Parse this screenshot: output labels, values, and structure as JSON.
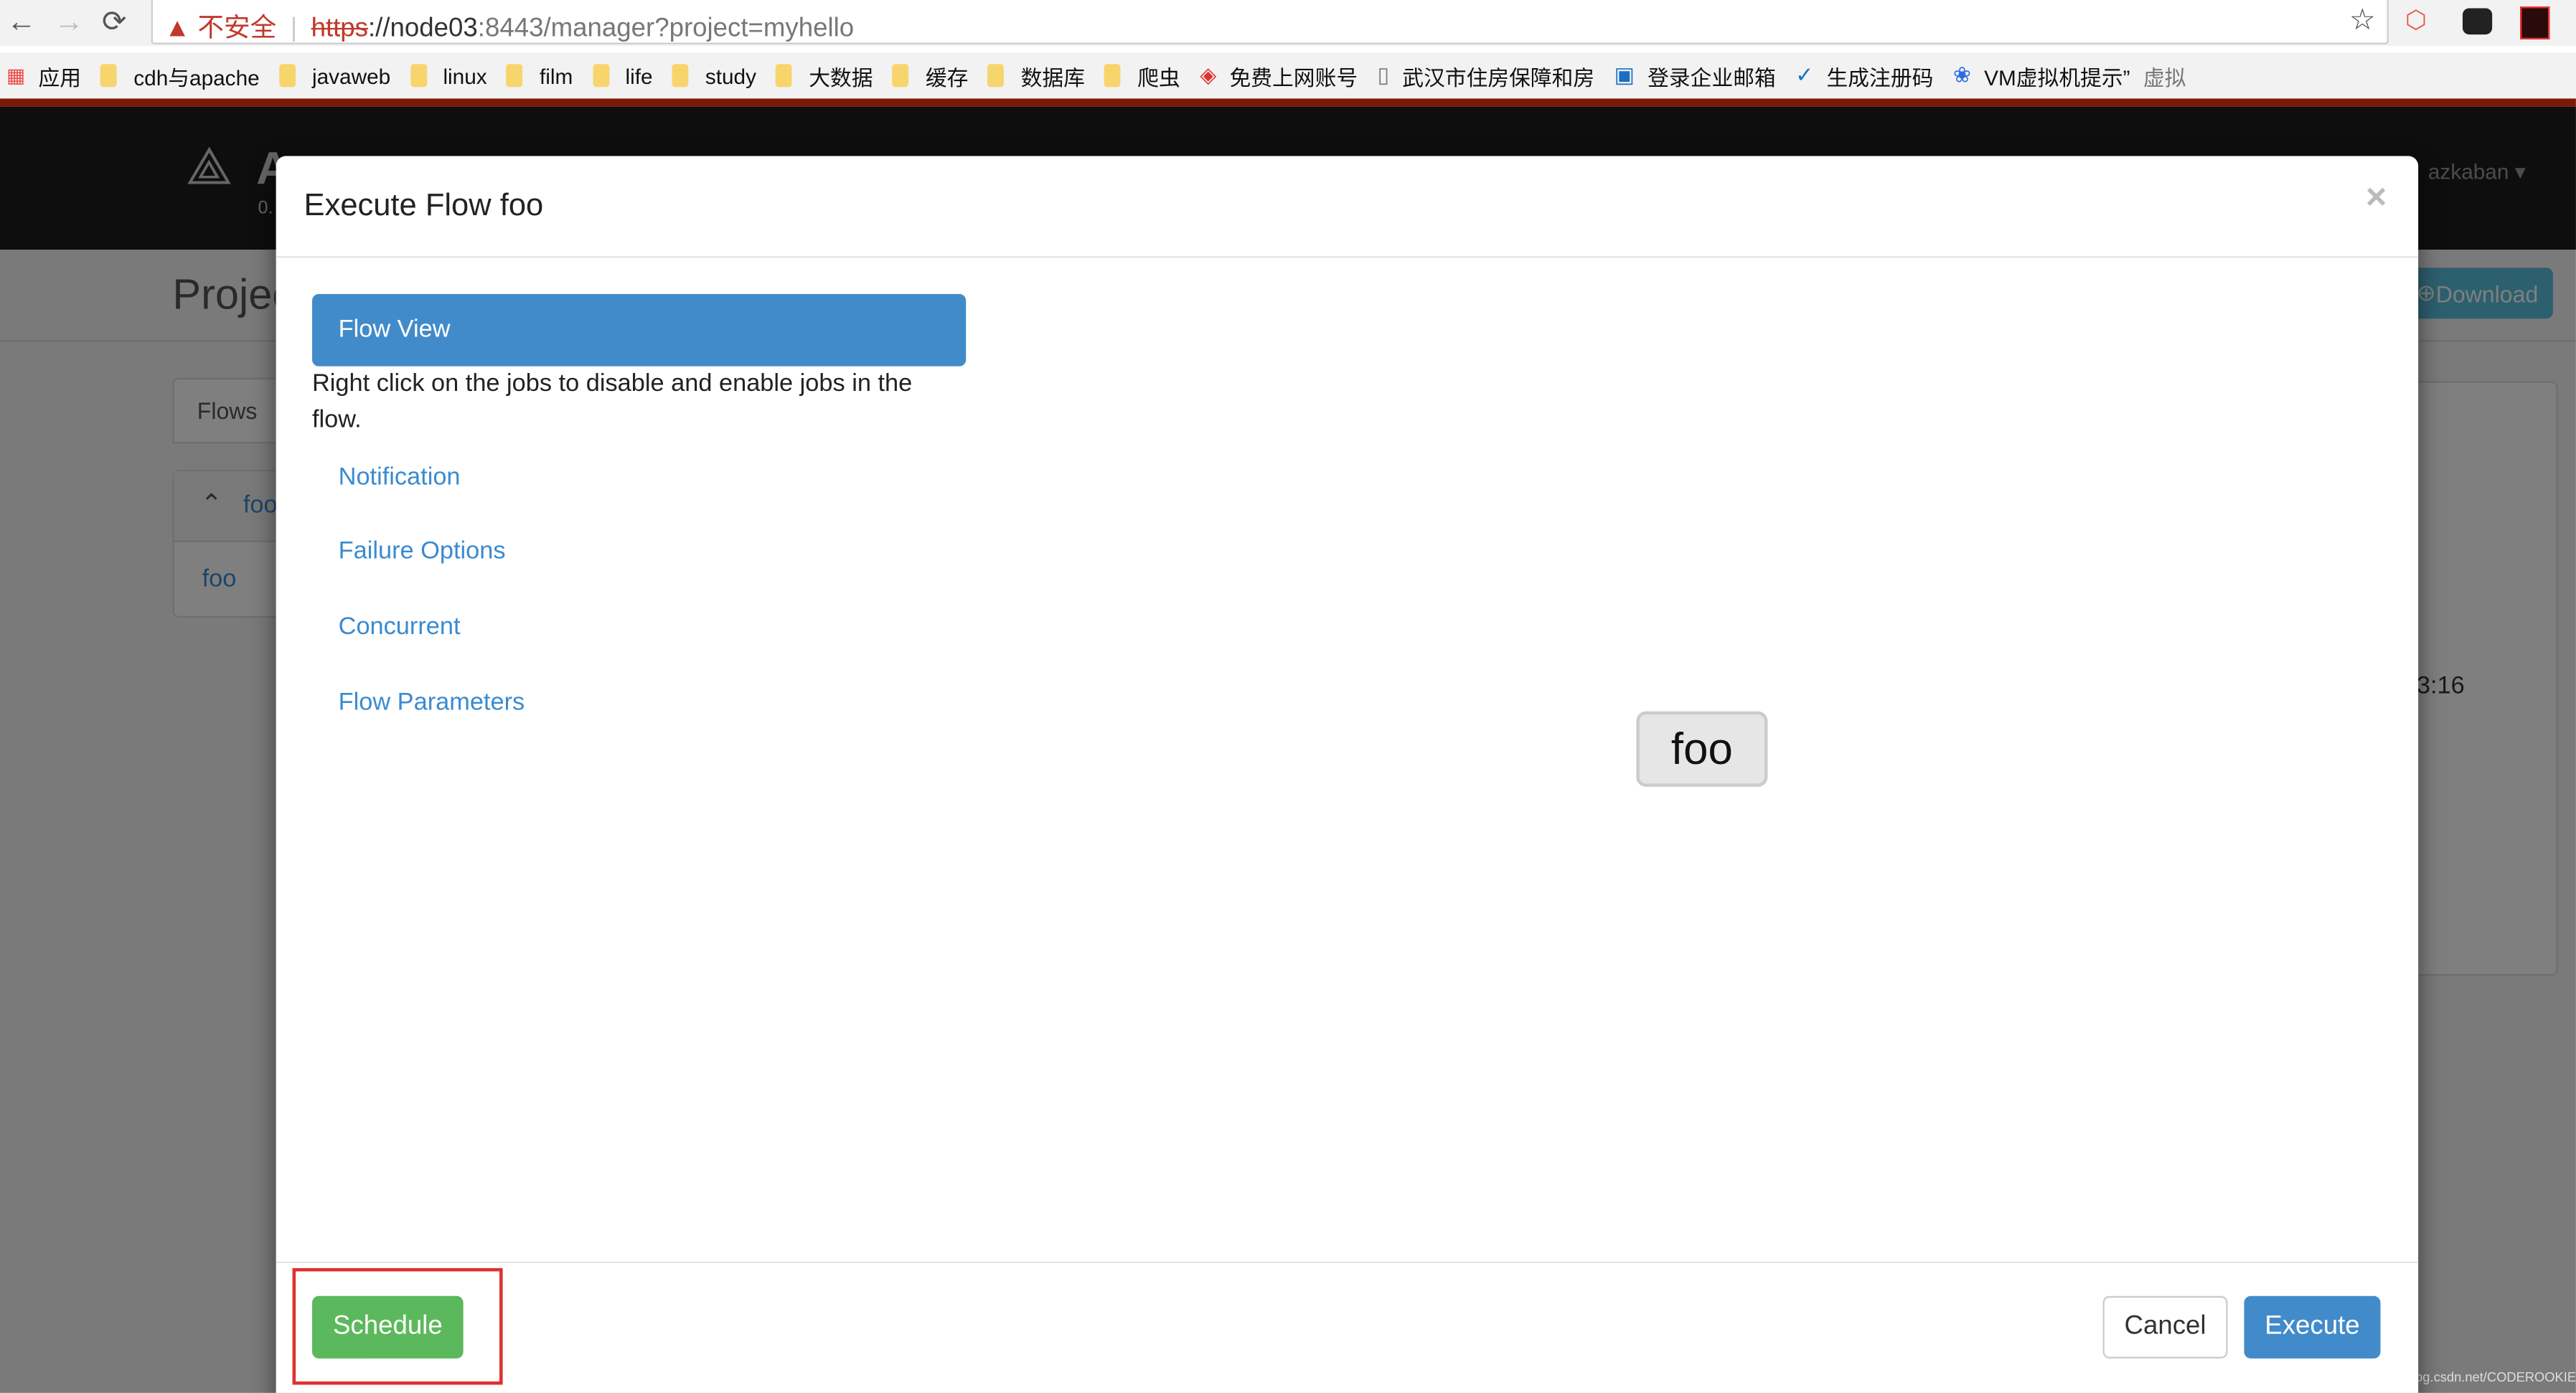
{
  "browser": {
    "security_label": "不安全",
    "url_scheme": "https",
    "url_host": "://node03",
    "url_rest": ":8443/manager?project=myhello",
    "bookmarks": [
      "应用",
      "cdh与apache",
      "javaweb",
      "linux",
      "film",
      "life",
      "study",
      "大数据",
      "缓存",
      "数据库",
      "爬虫",
      "免费上网账号",
      "武汉市住房保障和房",
      "登录企业邮箱",
      "生成注册码",
      "VM虚拟机提示”",
      "虚拟"
    ]
  },
  "background": {
    "logo_letter": "A",
    "version": "0.",
    "user_menu": "azkaban",
    "page_title": "Projec",
    "download_label": "Download",
    "flows_tab": "Flows",
    "flow_header": "foo",
    "flow_item": "foo",
    "time_fragment": "3:16"
  },
  "modal": {
    "title": "Execute Flow foo",
    "close": "×",
    "menu": {
      "active": "Flow View",
      "hint": "Right click on the jobs to disable and enable jobs in the flow.",
      "items": [
        "Notification",
        "Failure Options",
        "Concurrent",
        "Flow Parameters"
      ]
    },
    "graph_node": "foo",
    "footer": {
      "schedule": "Schedule",
      "cancel": "Cancel",
      "execute": "Execute"
    }
  },
  "watermark": "https://blog.csdn.net/CODEROOKIE_RUN",
  "colors": {
    "primary": "#428bca",
    "success": "#5cb85c",
    "highlight": "#e03030",
    "navbar": "#1c1c1c"
  }
}
